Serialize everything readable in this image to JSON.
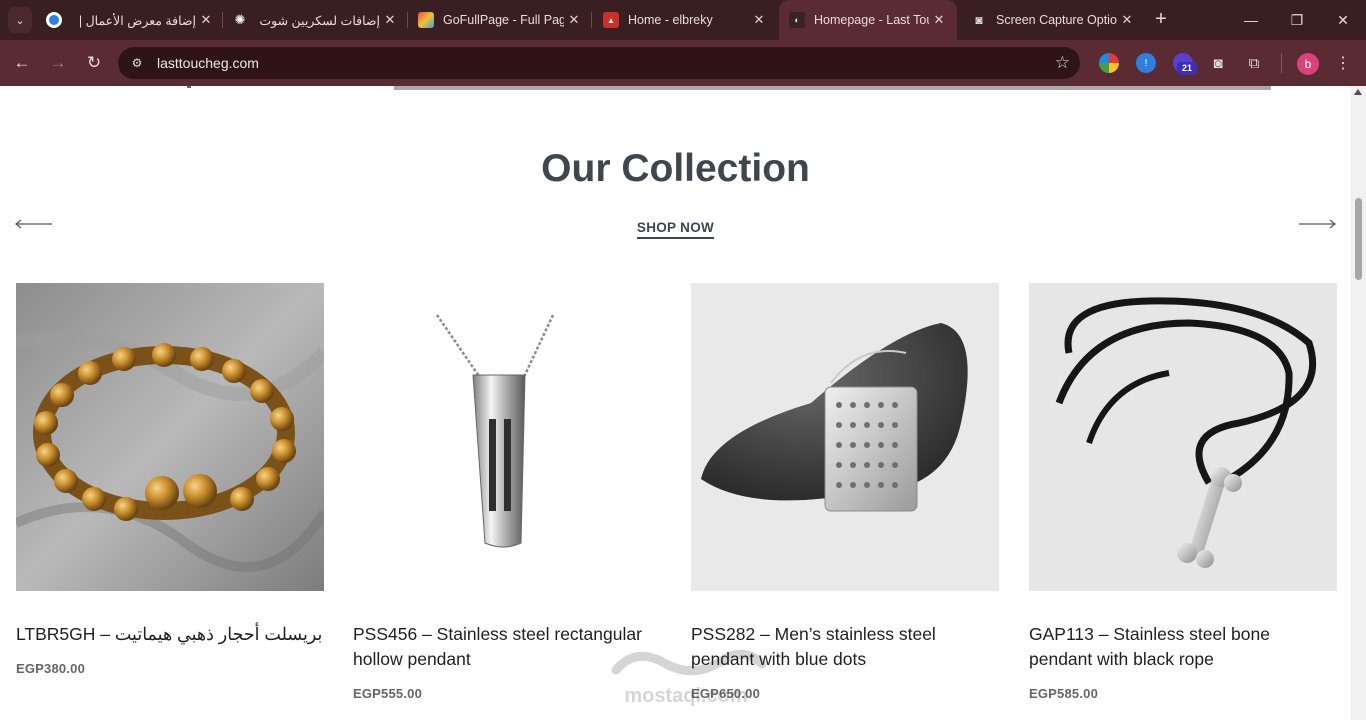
{
  "browser": {
    "tabs": [
      {
        "title": "إضافة معرض الأعمال |",
        "active": false
      },
      {
        "title": "إضافات لسكريين شوت",
        "active": false
      },
      {
        "title": "GoFullPage - Full Page",
        "active": false
      },
      {
        "title": "Home - elbreky",
        "active": false
      },
      {
        "title": "Homepage - Last Touch",
        "active": true
      },
      {
        "title": "Screen Capture Options",
        "active": false
      }
    ],
    "url": "lasttoucheg.com",
    "extension_badge": "21",
    "profile_initial": "b"
  },
  "section": {
    "heading": "Our Collection",
    "shop_now": "SHOP NOW"
  },
  "products": [
    {
      "name": "LTBR5GH – بريسلت أحجار ذهبي هيماتيت",
      "price": "EGP380.00"
    },
    {
      "name": "PSS456 – Stainless steel rectangular hollow pendant",
      "price": "EGP555.00"
    },
    {
      "name": "PSS282 – Men’s stainless steel pendant with blue dots",
      "price": "EGP650.00"
    },
    {
      "name": "GAP113 – Stainless steel bone pendant with black rope",
      "price": "EGP585.00"
    }
  ],
  "watermark": {
    "text": "mostaql.com"
  }
}
